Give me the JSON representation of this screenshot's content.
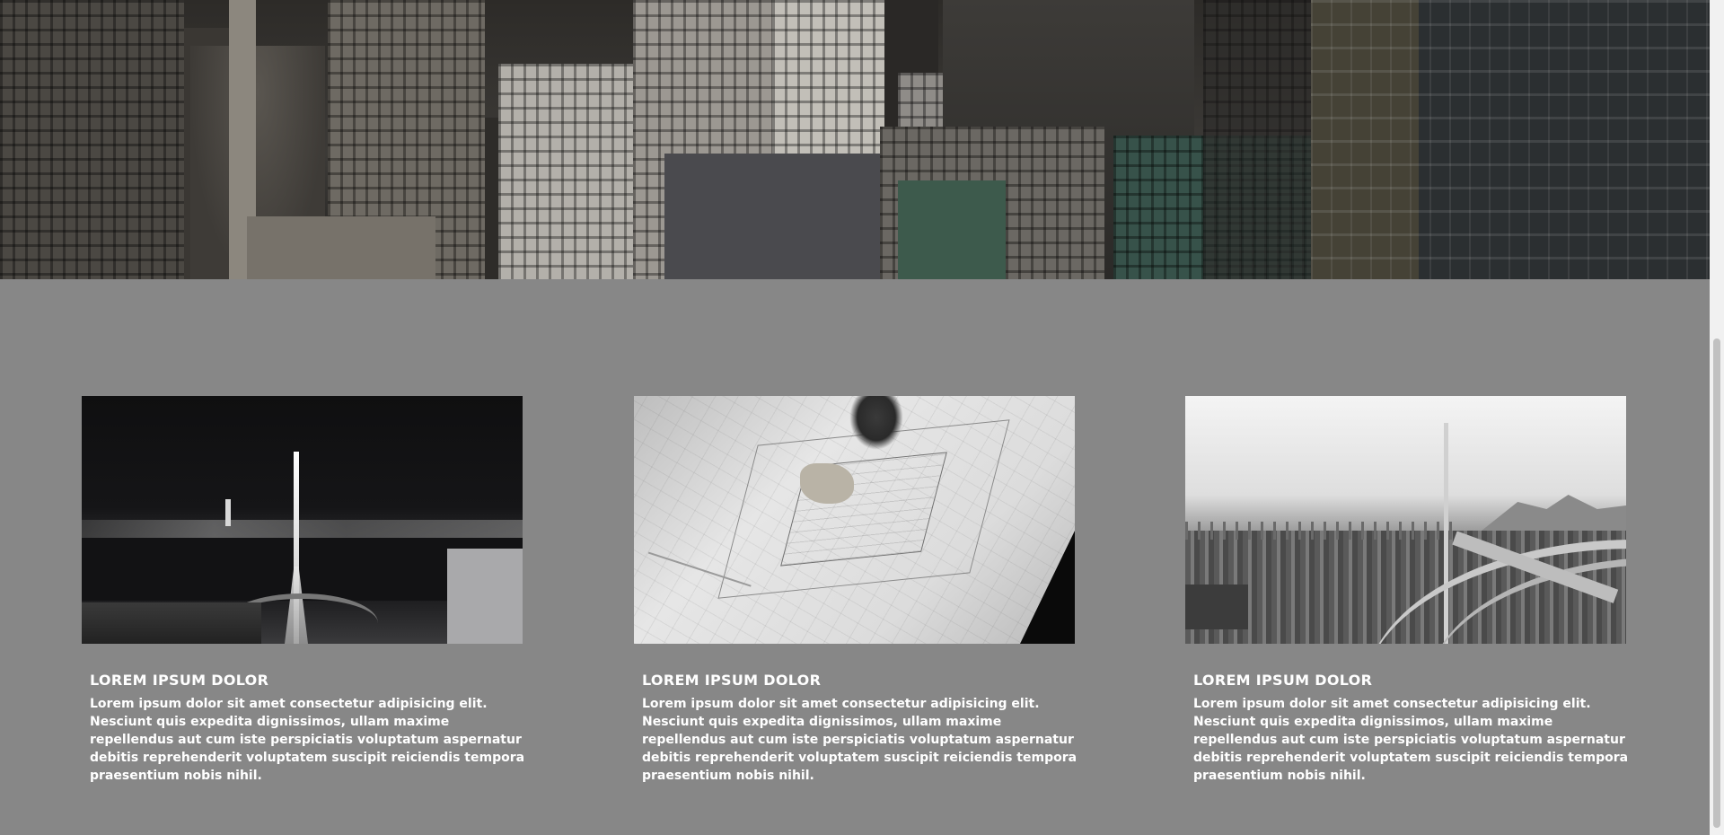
{
  "hero": {
    "image": "city-skyline-photo"
  },
  "cards": [
    {
      "image": "night-city-bridge-photo",
      "title": "LOREM IPSUM DOLOR",
      "text": "Lorem ipsum dolor sit amet consectetur adipisicing elit. Nesciunt quis expedita dignissimos, ullam maxime repellendus aut cum iste perspiciatis voluptatum aspernatur debitis reprehenderit voluptatem suscipit reiciendis tempora praesentium nobis nihil."
    },
    {
      "image": "architectural-blueprint-photo",
      "title": "LOREM IPSUM DOLOR",
      "text": "Lorem ipsum dolor sit amet consectetur adipisicing elit. Nesciunt quis expedita dignissimos, ullam maxime repellendus aut cum iste perspiciatis voluptatum aspernatur debitis reprehenderit voluptatem suscipit reiciendis tempora praesentium nobis nihil."
    },
    {
      "image": "cable-stayed-bridge-harbor-photo",
      "title": "LOREM IPSUM DOLOR",
      "text": "Lorem ipsum dolor sit amet consectetur adipisicing elit. Nesciunt quis expedita dignissimos, ullam maxime repellendus aut cum iste perspiciatis voluptatum aspernatur debitis reprehenderit voluptatem suscipit reiciendis tempora praesentium nobis nihil."
    }
  ],
  "colors": {
    "page_background": "#878787",
    "text": "#ffffff"
  }
}
